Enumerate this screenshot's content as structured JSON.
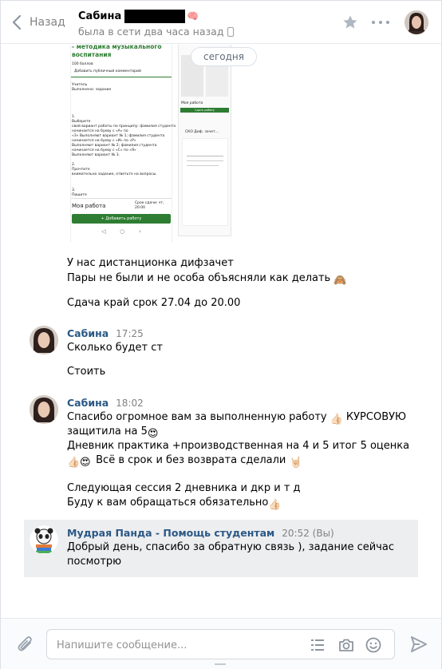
{
  "header": {
    "back_label": "Назад",
    "peer_name": "Сабина",
    "peer_status": "была в сети два часа назад"
  },
  "date_divider": "сегодня",
  "attachments": {
    "screenshot_left": {
      "title": "- методика музыкального воспитания",
      "lines": [
        "100 баллов",
        "Добавить публичный комментарий",
        "Учитель",
        "Выполнено: задание",
        "1.",
        "Выберите",
        "свой вариант работы по принципу: фамилия студента",
        "начинается на букву с «А» по",
        "«З» Выполняют вариант № 1; фамилия студента",
        "начинается на букву с «И» по «Р»",
        "Выполняют вариант № 2; фамилия студента",
        "начинается на букву с «С» по «Я»",
        "Выполняют вариант № 3.",
        "2.",
        "Прочтите",
        "внимательно задание, ответьте на вопросы.",
        "3.",
        "Пишите"
      ],
      "my_work": "Моя работа",
      "deadline": "Срок сдачи: чт, 20:00",
      "add_work": "+ Добавить работу"
    },
    "screenshot_right": {
      "label1": "Моя работа",
      "label2": "Сдать работу",
      "file": "СКО Диф. зачет..."
    }
  },
  "messages": [
    {
      "lines": [
        "У нас дистанционка дифзачет",
        "Пары не были и не особа объясняли как делать",
        "Сдача край срок 27.04 до 20.00"
      ]
    },
    {
      "author": "Сабина",
      "time": "17:25",
      "lines": [
        "Сколько будет ст",
        "Стоить"
      ]
    },
    {
      "author": "Сабина",
      "time": "18:02",
      "lines": [
        "Спасибо огромное вам за выполненную работу",
        "КУРСОВУЮ",
        "защитила на 5",
        "Дневник практика +производственная на 4 и 5 итог 5 оценка",
        "Всё в срок и без возврата сделали",
        "Следующая сессия 2 дневника и дкр и т д",
        "Буду к вам обращаться обязательно"
      ]
    },
    {
      "author": "Мудрая Панда - Помощь студентам",
      "time": "20:52",
      "you_marker": "(Вы)",
      "lines": [
        "Добрый день, спасибо за обратную связь ), задание сейчас",
        "посмотрю"
      ]
    }
  ],
  "composer": {
    "placeholder": "Напишите сообщение..."
  },
  "colors": {
    "author": "#2a5885",
    "muted": "#828282",
    "highlight": "#edeef0",
    "accent_green": "#2e7d32"
  },
  "icons": [
    "back-chevron-icon",
    "phone-icon",
    "star-icon",
    "more-icon",
    "paperclip-icon",
    "template-list-icon",
    "camera-icon",
    "smile-icon",
    "send-icon"
  ]
}
